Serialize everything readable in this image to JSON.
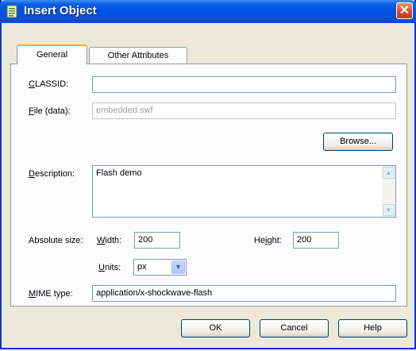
{
  "window": {
    "title": "Insert Object",
    "close_glyph": "✕"
  },
  "tabs": [
    {
      "label": "General",
      "active": true
    },
    {
      "label": "Other Attributes",
      "active": false
    }
  ],
  "fields": {
    "classid": {
      "label_access": "C",
      "label_rest": "LASSID:",
      "value": ""
    },
    "file": {
      "label_access": "F",
      "label_rest": "ile (data):",
      "value": "embedded.swf"
    },
    "browse_label": "Browse...",
    "description": {
      "label_access": "D",
      "label_rest": "escription:",
      "value": "Flash demo"
    },
    "absolute_size_label": "Absolute size:",
    "width": {
      "label_access": "W",
      "label_rest": "idth:",
      "value": "200"
    },
    "height": {
      "label_pre": "He",
      "label_access": "i",
      "label_rest": "ght:",
      "value": "200"
    },
    "units": {
      "label_access": "U",
      "label_rest": "nits:",
      "value": "px"
    },
    "mime": {
      "label_access": "M",
      "label_rest": "IME type:",
      "value": "application/x-shockwave-flash"
    }
  },
  "buttons": {
    "ok": "OK",
    "cancel": "Cancel",
    "help": "Help"
  },
  "icons": {
    "title": "document-icon",
    "close": "close-icon",
    "dropdown": "chevron-down-icon"
  }
}
